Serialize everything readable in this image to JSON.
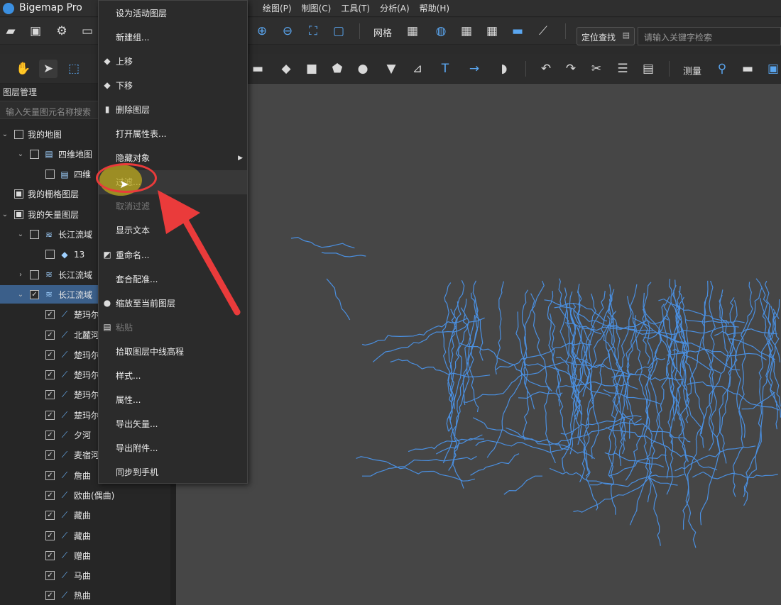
{
  "app": {
    "title": "Bigemap Pro"
  },
  "menubar": {
    "items": [
      "绘图(P)",
      "制图(C)",
      "工具(T)",
      "分析(A)",
      "帮助(H)"
    ],
    "partial_left": ")"
  },
  "toolbar1": {
    "grid_label": "网格",
    "locate_button": "定位查找",
    "search_placeholder": "请输入关键字检索"
  },
  "toolbar2": {
    "measure_label": "测量"
  },
  "left_panel": {
    "title": "图层管理",
    "search_placeholder": "输入矢量图元名称搜索",
    "tree": [
      {
        "label": "我的地图",
        "indent": 0,
        "expander": "v",
        "checkbox": "empty",
        "icon": ""
      },
      {
        "label": "四维地图",
        "indent": 1,
        "expander": "v",
        "checkbox": "empty",
        "icon": "map"
      },
      {
        "label": "四维",
        "indent": 2,
        "expander": "",
        "checkbox": "empty",
        "icon": "map"
      },
      {
        "label": "我的栅格图层",
        "indent": 0,
        "expander": "",
        "checkbox": "partial",
        "icon": ""
      },
      {
        "label": "我的矢量图层",
        "indent": 0,
        "expander": "v",
        "checkbox": "partial",
        "icon": ""
      },
      {
        "label": "长江流域",
        "indent": 1,
        "expander": "v",
        "checkbox": "empty",
        "icon": "layers"
      },
      {
        "label": "13",
        "indent": 2,
        "expander": "",
        "checkbox": "empty",
        "icon": "poly"
      },
      {
        "label": "长江流域",
        "indent": 1,
        "expander": ">",
        "checkbox": "empty",
        "icon": "layers"
      },
      {
        "label": "长江流域",
        "indent": 1,
        "expander": "v",
        "checkbox": "checked",
        "icon": "layers",
        "selected": true
      },
      {
        "label": "楚玛尔",
        "indent": 2,
        "expander": "",
        "checkbox": "checked",
        "icon": "line"
      },
      {
        "label": "北麓河",
        "indent": 2,
        "expander": "",
        "checkbox": "checked",
        "icon": "line"
      },
      {
        "label": "楚玛尔",
        "indent": 2,
        "expander": "",
        "checkbox": "checked",
        "icon": "line"
      },
      {
        "label": "楚玛尔",
        "indent": 2,
        "expander": "",
        "checkbox": "checked",
        "icon": "line"
      },
      {
        "label": "楚玛尔",
        "indent": 2,
        "expander": "",
        "checkbox": "checked",
        "icon": "line"
      },
      {
        "label": "楚玛尔",
        "indent": 2,
        "expander": "",
        "checkbox": "checked",
        "icon": "line"
      },
      {
        "label": "夕河",
        "indent": 2,
        "expander": "",
        "checkbox": "checked",
        "icon": "line"
      },
      {
        "label": "麦宿河",
        "indent": 2,
        "expander": "",
        "checkbox": "checked",
        "icon": "line"
      },
      {
        "label": "詹曲",
        "indent": 2,
        "expander": "",
        "checkbox": "checked",
        "icon": "line"
      },
      {
        "label": "欧曲(偶曲)",
        "indent": 2,
        "expander": "",
        "checkbox": "checked",
        "icon": "line"
      },
      {
        "label": "藏曲",
        "indent": 2,
        "expander": "",
        "checkbox": "checked",
        "icon": "line"
      },
      {
        "label": "藏曲",
        "indent": 2,
        "expander": "",
        "checkbox": "checked",
        "icon": "line"
      },
      {
        "label": "赠曲",
        "indent": 2,
        "expander": "",
        "checkbox": "checked",
        "icon": "line"
      },
      {
        "label": "马曲",
        "indent": 2,
        "expander": "",
        "checkbox": "checked",
        "icon": "line"
      },
      {
        "label": "热曲",
        "indent": 2,
        "expander": "",
        "checkbox": "checked",
        "icon": "line"
      }
    ]
  },
  "context_menu": {
    "items": [
      {
        "label": "设为活动图层",
        "icon": "",
        "state": "normal"
      },
      {
        "label": "新建组...",
        "icon": "",
        "state": "normal"
      },
      {
        "label": "上移",
        "icon": "up",
        "state": "normal"
      },
      {
        "label": "下移",
        "icon": "down",
        "state": "normal"
      },
      {
        "label": "删除图层",
        "icon": "trash",
        "state": "normal"
      },
      {
        "label": "打开属性表...",
        "icon": "",
        "state": "normal"
      },
      {
        "label": "隐藏对象",
        "icon": "",
        "state": "normal",
        "submenu": true
      },
      {
        "label": "过滤...",
        "icon": "",
        "state": "highlighted"
      },
      {
        "label": "取消过滤",
        "icon": "",
        "state": "disabled"
      },
      {
        "label": "显示文本",
        "icon": "",
        "state": "normal"
      },
      {
        "label": "重命名...",
        "icon": "rename",
        "state": "normal"
      },
      {
        "label": "套合配准...",
        "icon": "",
        "state": "normal"
      },
      {
        "label": "缩放至当前图层",
        "icon": "zoom",
        "state": "normal"
      },
      {
        "label": "粘贴",
        "icon": "paste",
        "state": "disabled"
      },
      {
        "label": "拾取图层中线高程",
        "icon": "",
        "state": "normal"
      },
      {
        "label": "样式...",
        "icon": "",
        "state": "normal"
      },
      {
        "label": "属性...",
        "icon": "",
        "state": "normal"
      },
      {
        "label": "导出矢量...",
        "icon": "",
        "state": "normal"
      },
      {
        "label": "导出附件...",
        "icon": "",
        "state": "normal"
      },
      {
        "label": "同步到手机",
        "icon": "",
        "state": "normal"
      }
    ]
  },
  "colors": {
    "accent": "#3b8fe0",
    "river": "#4a8fe0",
    "annotation": "#ea3b3b",
    "selection": "#3b5f8a"
  }
}
